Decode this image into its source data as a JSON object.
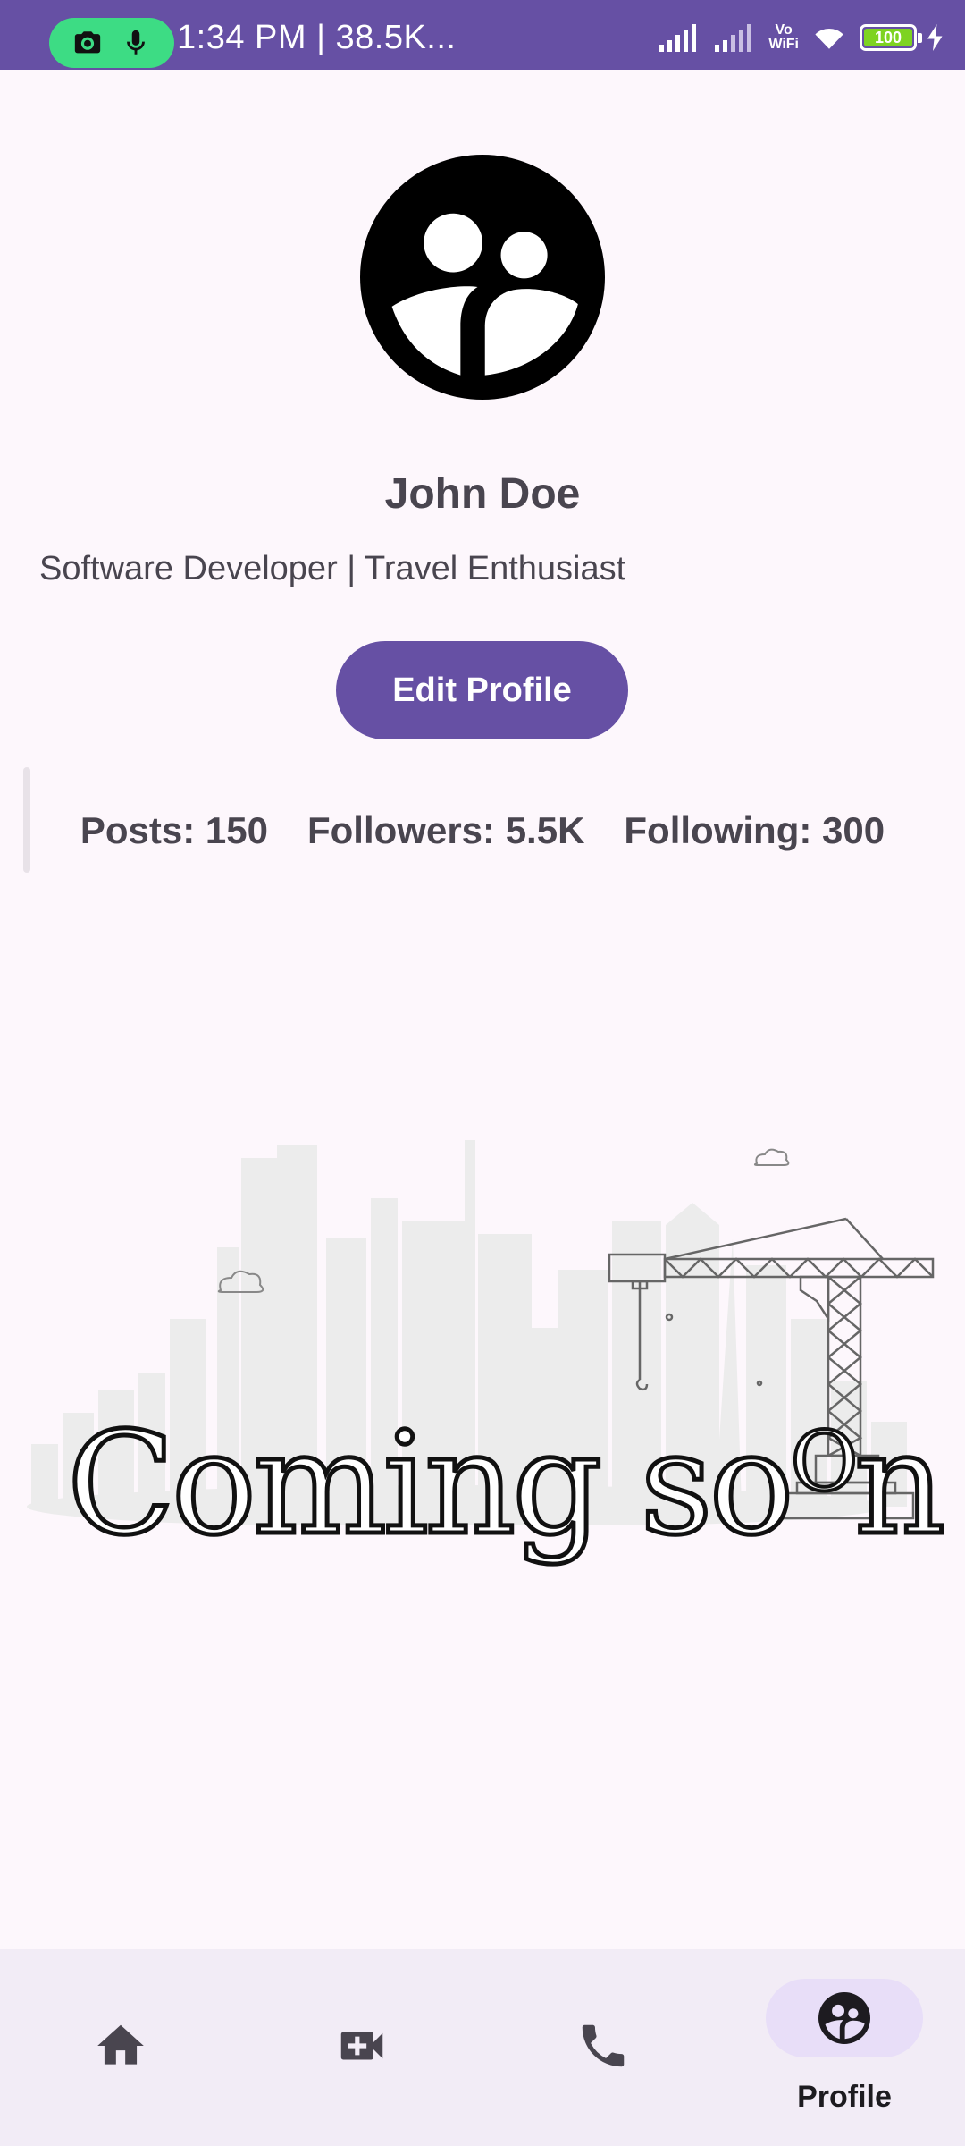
{
  "status_bar": {
    "time_text": "1:34 PM | 38.5K...",
    "vowifi_top": "Vo",
    "vowifi_bottom": "WiFi",
    "battery": "100",
    "accent": "#6650a4",
    "recording_color": "#3ddc84"
  },
  "profile": {
    "avatar_icon": "group-avatar-icon",
    "name": "John Doe",
    "bio": "Software Developer | Travel Enthusiast",
    "edit_label": "Edit Profile",
    "posts": "Posts: 150",
    "followers": "Followers: 5.5K",
    "following": "Following: 300"
  },
  "illustration": {
    "headline_part1": "Coming so",
    "headline_small_o": "O",
    "headline_part2": "n",
    "icon": "construction-crane-cityscape"
  },
  "bottom_nav": {
    "items": [
      {
        "icon": "home-icon"
      },
      {
        "icon": "video-call-icon"
      },
      {
        "icon": "phone-icon"
      },
      {
        "icon": "profile-icon",
        "label": "Profile",
        "selected": true
      }
    ],
    "selected_color": "#e8def8"
  }
}
